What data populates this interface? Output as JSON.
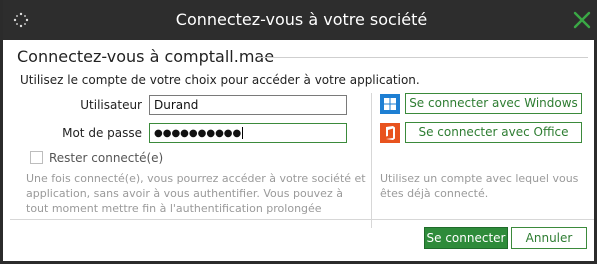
{
  "window": {
    "title": "Connectez-vous à votre société"
  },
  "main": {
    "heading": "Connectez-vous à comptall.mae",
    "subtitle": "Utilisez le compte de votre choix pour accéder à votre application.",
    "username_label": "Utilisateur",
    "username_value": "Durand",
    "password_label": "Mot de passe",
    "password_masked": "●●●●●●●●●●",
    "remember_label": "Rester connecté(e)",
    "remember_checked": false,
    "help_left": "Une fois connecté(e), vous pourrez accéder à votre société et application, sans avoir à vous authentifier. Vous pouvez à tout moment mettre fin à l'authentification prolongée",
    "help_right": "Utilisez un compte avec lequel vous êtes déjà connecté."
  },
  "providers": {
    "windows_label": "Se connecter avec Windows",
    "office_label": "Se connecter avec Office"
  },
  "footer": {
    "connect_label": "Se connecter",
    "cancel_label": "Annuler"
  },
  "colors": {
    "titlebar": "#2d2d2d",
    "accent_green": "#2e8b3a",
    "close_icon": "#3aa845",
    "windows_blue": "#1e7fd3",
    "office_orange": "#e8531e"
  }
}
